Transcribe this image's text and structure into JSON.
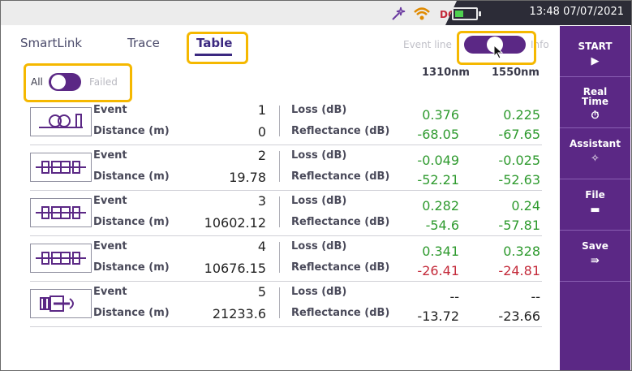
{
  "status": {
    "datetime": "13:48 07/07/2021"
  },
  "tabs": [
    {
      "label": "SmartLink"
    },
    {
      "label": "Trace"
    },
    {
      "label": "Table"
    }
  ],
  "view_toggle": {
    "left_label": "Event line",
    "right_label": "Info",
    "state": "right"
  },
  "filter_toggle": {
    "on_label": "All",
    "off_label": "Failed",
    "state": "All"
  },
  "columns": {
    "wl1": "1310nm",
    "wl2": "1550nm"
  },
  "labels": {
    "event": "Event",
    "distance": "Distance (m)",
    "loss": "Loss  (dB)",
    "reflectance": "Reflectance (dB)"
  },
  "events": [
    {
      "icon": "connector-ring-icon",
      "event": "1",
      "distance": "0",
      "loss1310": "0.376",
      "loss1550": "0.225",
      "refl1310": "-68.05",
      "refl1550": "-67.65"
    },
    {
      "icon": "splice-connector-icon",
      "event": "2",
      "distance": "19.78",
      "loss1310": "-0.049",
      "loss1550": "-0.025",
      "refl1310": "-52.21",
      "refl1550": "-52.63"
    },
    {
      "icon": "splice-connector-icon",
      "event": "3",
      "distance": "10602.12",
      "loss1310": "0.282",
      "loss1550": "0.24",
      "refl1310": "-54.6",
      "refl1550": "-57.81"
    },
    {
      "icon": "splice-connector-icon",
      "event": "4",
      "distance": "10676.15",
      "loss1310": "0.341",
      "loss1550": "0.328",
      "refl1310": "-26.41",
      "refl1550": "-24.81"
    },
    {
      "icon": "fiber-end-icon",
      "event": "5",
      "distance": "21233.6",
      "loss1310": "--",
      "loss1550": "--",
      "refl1310": "-13.72",
      "refl1550": "-23.66"
    }
  ],
  "sidebar": [
    {
      "label": "START",
      "icon": "play-icon",
      "glyph": "▶"
    },
    {
      "label": "Real Time",
      "icon": "timer-icon",
      "glyph": "⏱"
    },
    {
      "label": "Assistant",
      "icon": "wand-icon",
      "glyph": "✧"
    },
    {
      "label": "File",
      "icon": "folder-icon",
      "glyph": "▬"
    },
    {
      "label": "Save",
      "icon": "save-icon",
      "glyph": "⇛"
    }
  ],
  "colors": {
    "accent": "#5b2885",
    "highlight": "#f5b800",
    "pass": "#2e9a2e",
    "fail": "#c42a3a"
  }
}
